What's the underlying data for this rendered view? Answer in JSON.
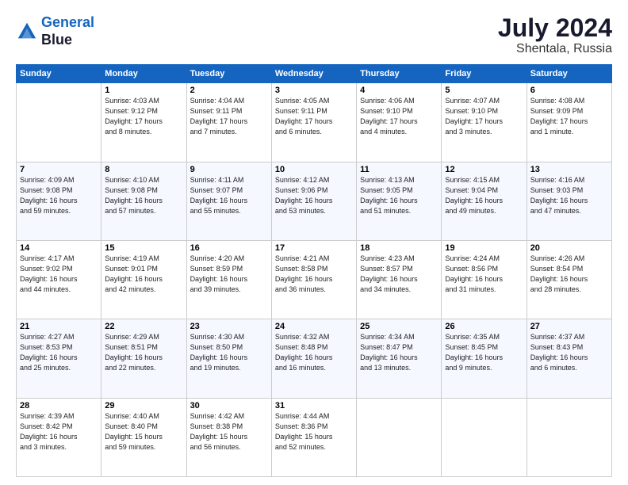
{
  "header": {
    "logo_line1": "General",
    "logo_line2": "Blue",
    "main_title": "July 2024",
    "subtitle": "Shentala, Russia"
  },
  "calendar": {
    "days_of_week": [
      "Sunday",
      "Monday",
      "Tuesday",
      "Wednesday",
      "Thursday",
      "Friday",
      "Saturday"
    ],
    "weeks": [
      [
        {
          "day": "",
          "detail": ""
        },
        {
          "day": "1",
          "detail": "Sunrise: 4:03 AM\nSunset: 9:12 PM\nDaylight: 17 hours\nand 8 minutes."
        },
        {
          "day": "2",
          "detail": "Sunrise: 4:04 AM\nSunset: 9:11 PM\nDaylight: 17 hours\nand 7 minutes."
        },
        {
          "day": "3",
          "detail": "Sunrise: 4:05 AM\nSunset: 9:11 PM\nDaylight: 17 hours\nand 6 minutes."
        },
        {
          "day": "4",
          "detail": "Sunrise: 4:06 AM\nSunset: 9:10 PM\nDaylight: 17 hours\nand 4 minutes."
        },
        {
          "day": "5",
          "detail": "Sunrise: 4:07 AM\nSunset: 9:10 PM\nDaylight: 17 hours\nand 3 minutes."
        },
        {
          "day": "6",
          "detail": "Sunrise: 4:08 AM\nSunset: 9:09 PM\nDaylight: 17 hours\nand 1 minute."
        }
      ],
      [
        {
          "day": "7",
          "detail": "Sunrise: 4:09 AM\nSunset: 9:08 PM\nDaylight: 16 hours\nand 59 minutes."
        },
        {
          "day": "8",
          "detail": "Sunrise: 4:10 AM\nSunset: 9:08 PM\nDaylight: 16 hours\nand 57 minutes."
        },
        {
          "day": "9",
          "detail": "Sunrise: 4:11 AM\nSunset: 9:07 PM\nDaylight: 16 hours\nand 55 minutes."
        },
        {
          "day": "10",
          "detail": "Sunrise: 4:12 AM\nSunset: 9:06 PM\nDaylight: 16 hours\nand 53 minutes."
        },
        {
          "day": "11",
          "detail": "Sunrise: 4:13 AM\nSunset: 9:05 PM\nDaylight: 16 hours\nand 51 minutes."
        },
        {
          "day": "12",
          "detail": "Sunrise: 4:15 AM\nSunset: 9:04 PM\nDaylight: 16 hours\nand 49 minutes."
        },
        {
          "day": "13",
          "detail": "Sunrise: 4:16 AM\nSunset: 9:03 PM\nDaylight: 16 hours\nand 47 minutes."
        }
      ],
      [
        {
          "day": "14",
          "detail": "Sunrise: 4:17 AM\nSunset: 9:02 PM\nDaylight: 16 hours\nand 44 minutes."
        },
        {
          "day": "15",
          "detail": "Sunrise: 4:19 AM\nSunset: 9:01 PM\nDaylight: 16 hours\nand 42 minutes."
        },
        {
          "day": "16",
          "detail": "Sunrise: 4:20 AM\nSunset: 8:59 PM\nDaylight: 16 hours\nand 39 minutes."
        },
        {
          "day": "17",
          "detail": "Sunrise: 4:21 AM\nSunset: 8:58 PM\nDaylight: 16 hours\nand 36 minutes."
        },
        {
          "day": "18",
          "detail": "Sunrise: 4:23 AM\nSunset: 8:57 PM\nDaylight: 16 hours\nand 34 minutes."
        },
        {
          "day": "19",
          "detail": "Sunrise: 4:24 AM\nSunset: 8:56 PM\nDaylight: 16 hours\nand 31 minutes."
        },
        {
          "day": "20",
          "detail": "Sunrise: 4:26 AM\nSunset: 8:54 PM\nDaylight: 16 hours\nand 28 minutes."
        }
      ],
      [
        {
          "day": "21",
          "detail": "Sunrise: 4:27 AM\nSunset: 8:53 PM\nDaylight: 16 hours\nand 25 minutes."
        },
        {
          "day": "22",
          "detail": "Sunrise: 4:29 AM\nSunset: 8:51 PM\nDaylight: 16 hours\nand 22 minutes."
        },
        {
          "day": "23",
          "detail": "Sunrise: 4:30 AM\nSunset: 8:50 PM\nDaylight: 16 hours\nand 19 minutes."
        },
        {
          "day": "24",
          "detail": "Sunrise: 4:32 AM\nSunset: 8:48 PM\nDaylight: 16 hours\nand 16 minutes."
        },
        {
          "day": "25",
          "detail": "Sunrise: 4:34 AM\nSunset: 8:47 PM\nDaylight: 16 hours\nand 13 minutes."
        },
        {
          "day": "26",
          "detail": "Sunrise: 4:35 AM\nSunset: 8:45 PM\nDaylight: 16 hours\nand 9 minutes."
        },
        {
          "day": "27",
          "detail": "Sunrise: 4:37 AM\nSunset: 8:43 PM\nDaylight: 16 hours\nand 6 minutes."
        }
      ],
      [
        {
          "day": "28",
          "detail": "Sunrise: 4:39 AM\nSunset: 8:42 PM\nDaylight: 16 hours\nand 3 minutes."
        },
        {
          "day": "29",
          "detail": "Sunrise: 4:40 AM\nSunset: 8:40 PM\nDaylight: 15 hours\nand 59 minutes."
        },
        {
          "day": "30",
          "detail": "Sunrise: 4:42 AM\nSunset: 8:38 PM\nDaylight: 15 hours\nand 56 minutes."
        },
        {
          "day": "31",
          "detail": "Sunrise: 4:44 AM\nSunset: 8:36 PM\nDaylight: 15 hours\nand 52 minutes."
        },
        {
          "day": "",
          "detail": ""
        },
        {
          "day": "",
          "detail": ""
        },
        {
          "day": "",
          "detail": ""
        }
      ]
    ]
  }
}
